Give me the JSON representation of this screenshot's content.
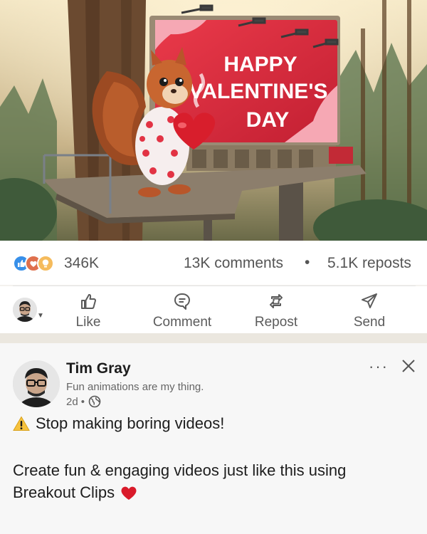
{
  "media": {
    "billboard_text": [
      "HAPPY",
      "VALENTINE'S",
      "DAY"
    ],
    "colors": {
      "billboard_red": "#d8283a",
      "sky": "#e8d9b8",
      "forest": "#3f5a3a",
      "squirrel": "#b8562a"
    }
  },
  "social_counts": {
    "reaction_icons": [
      "like-icon",
      "love-icon",
      "insightful-icon"
    ],
    "reactions": "346K",
    "comments": "13K comments",
    "separator": "•",
    "reposts": "5.1K reposts"
  },
  "actions": [
    {
      "label": "Like",
      "icon": "thumbs-up-icon"
    },
    {
      "label": "Comment",
      "icon": "comment-icon"
    },
    {
      "label": "Repost",
      "icon": "repost-icon"
    },
    {
      "label": "Send",
      "icon": "send-icon"
    }
  ],
  "post": {
    "author_name": "Tim Gray",
    "author_headline": "Fun animations are my thing.",
    "time": "2d",
    "meta_separator": "•",
    "more_label": "···",
    "text_line1": "Stop making boring videos!",
    "text_line2": "Create fun & engaging videos just like this using",
    "text_line3": "Breakout Clips"
  },
  "colors": {
    "accent_blue": "#378fe9",
    "text_gray": "#5b5b5b",
    "band": "#ebe7df"
  }
}
